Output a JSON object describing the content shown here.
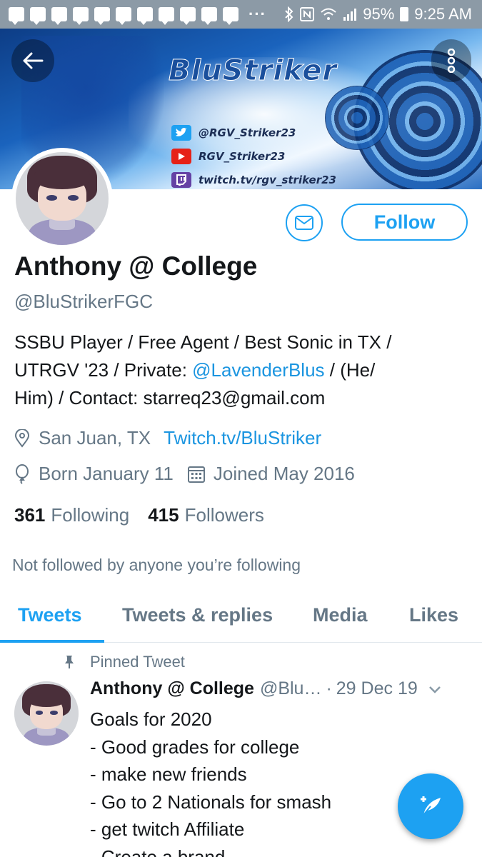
{
  "status_bar": {
    "overflow": "···",
    "battery": "95%",
    "time": "9:25 AM",
    "icons": [
      "notification-icon",
      "bluetooth-icon",
      "nfc-icon",
      "wifi-icon",
      "signal-icon",
      "battery-icon"
    ]
  },
  "banner": {
    "title": "BluStriker",
    "twitter": "@RGV_Striker23",
    "youtube": "RGV_Striker23",
    "twitch": "twitch.tv/rgv_striker23"
  },
  "profile": {
    "name": "Anthony @ College",
    "handle": "@BluStrikerFGC",
    "follow_label": "Follow",
    "bio_line1": "SSBU Player / Free Agent / Best Sonic in TX  /",
    "bio_line2_pre": "UTRGV '23 / Private: ",
    "bio_mention": "@LavenderBlus",
    "bio_line2_post": " / (He/",
    "bio_line3": "Him) / Contact: starreq23@gmail.com",
    "location": "San Juan, TX",
    "website": "Twitch.tv/BluStriker",
    "birthday": "Born January 11",
    "joined": "Joined May 2016",
    "following_count": "361",
    "following_label": "Following",
    "followers_count": "415",
    "followers_label": "Followers",
    "not_followed": "Not followed by anyone you’re following"
  },
  "tabs": [
    "Tweets",
    "Tweets & replies",
    "Media",
    "Likes"
  ],
  "pinned_tweet": {
    "pinned_label": "Pinned Tweet",
    "author": "Anthony @ College",
    "handle": "@Blu…",
    "separator": "·",
    "date": "29 Dec 19",
    "lines": [
      "Goals for 2020",
      "- Good grades for college",
      "- make new friends",
      "- Go to 2 Nationals for smash",
      "- get twitch Affiliate",
      "- Create a brand"
    ]
  },
  "colors": {
    "accent": "#1da1f2",
    "link": "#1b95e0",
    "secondary_text": "#657786",
    "status_bar": "#8c9aa6"
  }
}
